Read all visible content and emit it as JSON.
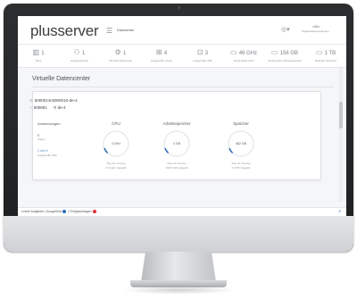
{
  "header": {
    "logo": "plusserver",
    "menu_icon": "hamburger-icon",
    "section": "Datacenter",
    "user_icon": "user-icon",
    "user_id": "&lt;ID&gt;",
    "user_sub": "Organisationseinheiten ·"
  },
  "stats": [
    {
      "value": "1",
      "label": "Sites",
      "icon": "building-icon",
      "glyph": "▥"
    },
    {
      "value": "1",
      "label": "Organisationen",
      "icon": "users-icon",
      "glyph": "⚇"
    },
    {
      "value": "1",
      "label": "Virtuelle Datacenter",
      "icon": "network-icon",
      "glyph": "⚙"
    },
    {
      "value": "4",
      "label": "Ausgerollte vApps",
      "icon": "grid-icon",
      "glyph": "⊞"
    },
    {
      "value": "3",
      "label": "Ausgerollte VMs",
      "icon": "vm-icon",
      "glyph": "⊡"
    },
    {
      "value": "46 GHz",
      "label": "Verwendete CPU",
      "icon": "cpu-icon",
      "glyph": "▭"
    },
    {
      "value": "156 GB",
      "label": "Verwendeter Arbeitsspeicher",
      "icon": "memory-icon",
      "glyph": "▭"
    },
    {
      "value": "1 TB",
      "label": "Belegter Speicher",
      "icon": "storage-icon",
      "glyph": "▭"
    }
  ],
  "main": {
    "title": "Virtuelle Datencenter",
    "card": {
      "id": "5000014c5000010-de-4",
      "line2_id": "500691",
      "line2_tag": "de-4",
      "apps": {
        "title": "Anwendungen",
        "count": "0",
        "count_label": "vApps",
        "link": "1 von 3",
        "link_sub": "Ausgerollte VMs"
      },
      "metrics": [
        {
          "title": "CPU",
          "value": "4 GHz",
          "sub1": "Pay-As-You-Go",
          "sub2": "0.0 GHz zugeteilt",
          "fraction": 0.06,
          "color": "#2f6db5"
        },
        {
          "title": "Arbeitsspeicher",
          "value": "4 GB",
          "sub1": "Pay-As-You-Go",
          "sub2": "100.0 GB zugeteilt",
          "fraction": 0.06,
          "color": "#2f6db5"
        },
        {
          "title": "Speicher",
          "value": "482 GB",
          "sub1": "Pay-As-You-Go",
          "sub2": "4.0 TB zugeteilt",
          "fraction": 0.06,
          "color": "#2f6db5"
        }
      ]
    }
  },
  "statusbar": {
    "text1": "Letzte Aufgaben",
    "text2": "Ausgeführt",
    "text3": "Fehlgeschlagen",
    "dot1_color": "#2f6db5",
    "dot2_color": "#e0303b",
    "close_icon": "close-icon"
  }
}
